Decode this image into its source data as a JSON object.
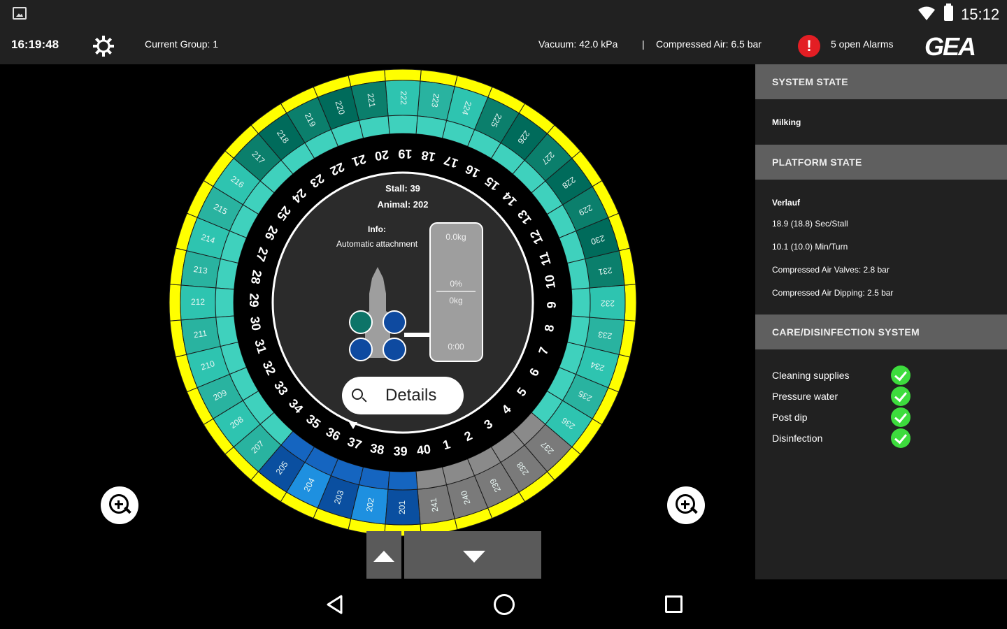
{
  "status_bar": {
    "clock": "15:12"
  },
  "header": {
    "time": "16:19:48",
    "current_group": "Current Group: 1",
    "vacuum": "Vacuum: 42.0 kPa",
    "separator": "|",
    "compressed_air": "Compressed Air: 6.5 bar",
    "alarm_symbol": "!",
    "alarms": "5 open Alarms",
    "logo": "GEA",
    "alarm_color": "#e31e24"
  },
  "carousel": {
    "inner_stalls": [
      "1",
      "2",
      "3",
      "4",
      "5",
      "6",
      "7",
      "8",
      "9",
      "10",
      "11",
      "12",
      "13",
      "14",
      "15",
      "16",
      "17",
      "18",
      "19",
      "20",
      "21",
      "22",
      "23",
      "24",
      "25",
      "26",
      "27",
      "28",
      "29",
      "30",
      "31",
      "32",
      "33",
      "34",
      "35",
      "36",
      "37",
      "38",
      "39",
      "40"
    ],
    "outer_animals": [
      "241",
      "240",
      "239",
      "238",
      "237",
      "236",
      "235",
      "234",
      "233",
      "232",
      "231",
      "230",
      "229",
      "228",
      "227",
      "226",
      "225",
      "224",
      "223",
      "222",
      "221",
      "220",
      "219",
      "218",
      "217",
      "216",
      "215",
      "214",
      "213",
      "212",
      "211",
      "210",
      "209",
      "208",
      "207",
      "205",
      "204",
      "203",
      "202",
      "201"
    ],
    "stall_info": "Stall: 39",
    "animal_info": "Animal: 202",
    "info_label": "Info:",
    "info_text": "Automatic attachment",
    "yield_top": "0.0kg",
    "yield_percent": "0%",
    "yield_kg": "0kg",
    "yield_time": "0:00",
    "details_label": "Details",
    "colors": {
      "ring": "#ffff00",
      "teal_dark": "#006b5b",
      "teal_light": "#2ec4b0",
      "blue_dark": "#0a4fa0",
      "blue_light": "#1e90e0",
      "grey": "#7a7a7a"
    }
  },
  "panel": {
    "system_state_header": "SYSTEM STATE",
    "system_state_value": "Milking",
    "platform_state_header": "PLATFORM STATE",
    "verlauf": "Verlauf",
    "sec_stall": "18.9 (18.8) Sec/Stall",
    "min_turn": "10.1 (10.0) Min/Turn",
    "air_valves": "Compressed Air Valves:  2.8 bar",
    "air_dipping": "Compressed Air Dipping:  2.5 bar",
    "care_header": "CARE/DISINFECTION SYSTEM",
    "care_items": [
      "Cleaning supplies",
      "Pressure water",
      "Post dip",
      "Disinfection"
    ]
  }
}
